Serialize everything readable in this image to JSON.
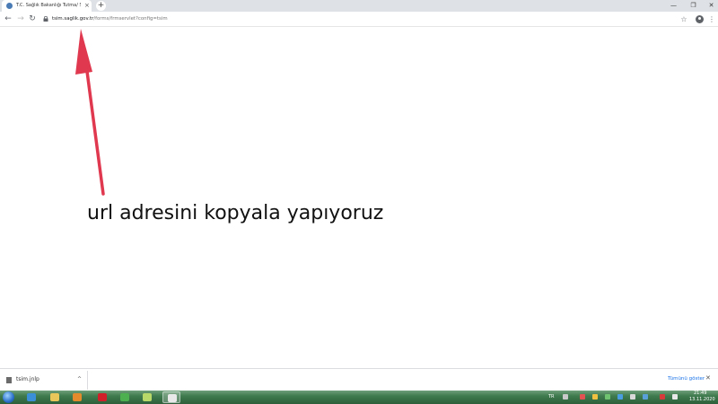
{
  "browser": {
    "tab": {
      "title": "T.C. Sağlık Bakanlığı Tutma/ Sağlık",
      "close_glyph": "×"
    },
    "new_tab_glyph": "+",
    "window_controls": {
      "minimize": "—",
      "maximize": "❐",
      "close": "✕"
    },
    "toolbar": {
      "back_glyph": "←",
      "forward_glyph": "→",
      "reload_glyph": "↻",
      "url_host": "tsim.saglik.gov.tr",
      "url_path": "/forms/frmservlet?config=tsim",
      "bookmark_glyph": "☆",
      "menu_glyph": "⋮"
    }
  },
  "content": {
    "caption": "url adresini kopyala yapıyoruz",
    "arrow_color": "#e0394f"
  },
  "download_bar": {
    "file_name": "tsim.jnlp",
    "chevron": "^",
    "show_all_label": "Tümünü göster",
    "close_glyph": "✕"
  },
  "taskbar": {
    "language": "TR",
    "time": "21:49",
    "date": "13.11.2020",
    "apps": [
      {
        "name": "internet-explorer",
        "color": "#3a8fd6"
      },
      {
        "name": "file-explorer",
        "color": "#e8c65a"
      },
      {
        "name": "media-player",
        "color": "#e38b2c"
      },
      {
        "name": "opera",
        "color": "#d0212a"
      },
      {
        "name": "chrome",
        "color": "#4caf50"
      },
      {
        "name": "notes",
        "color": "#b9d86a"
      },
      {
        "name": "java-launcher",
        "color": "#e9e9e9"
      }
    ]
  }
}
